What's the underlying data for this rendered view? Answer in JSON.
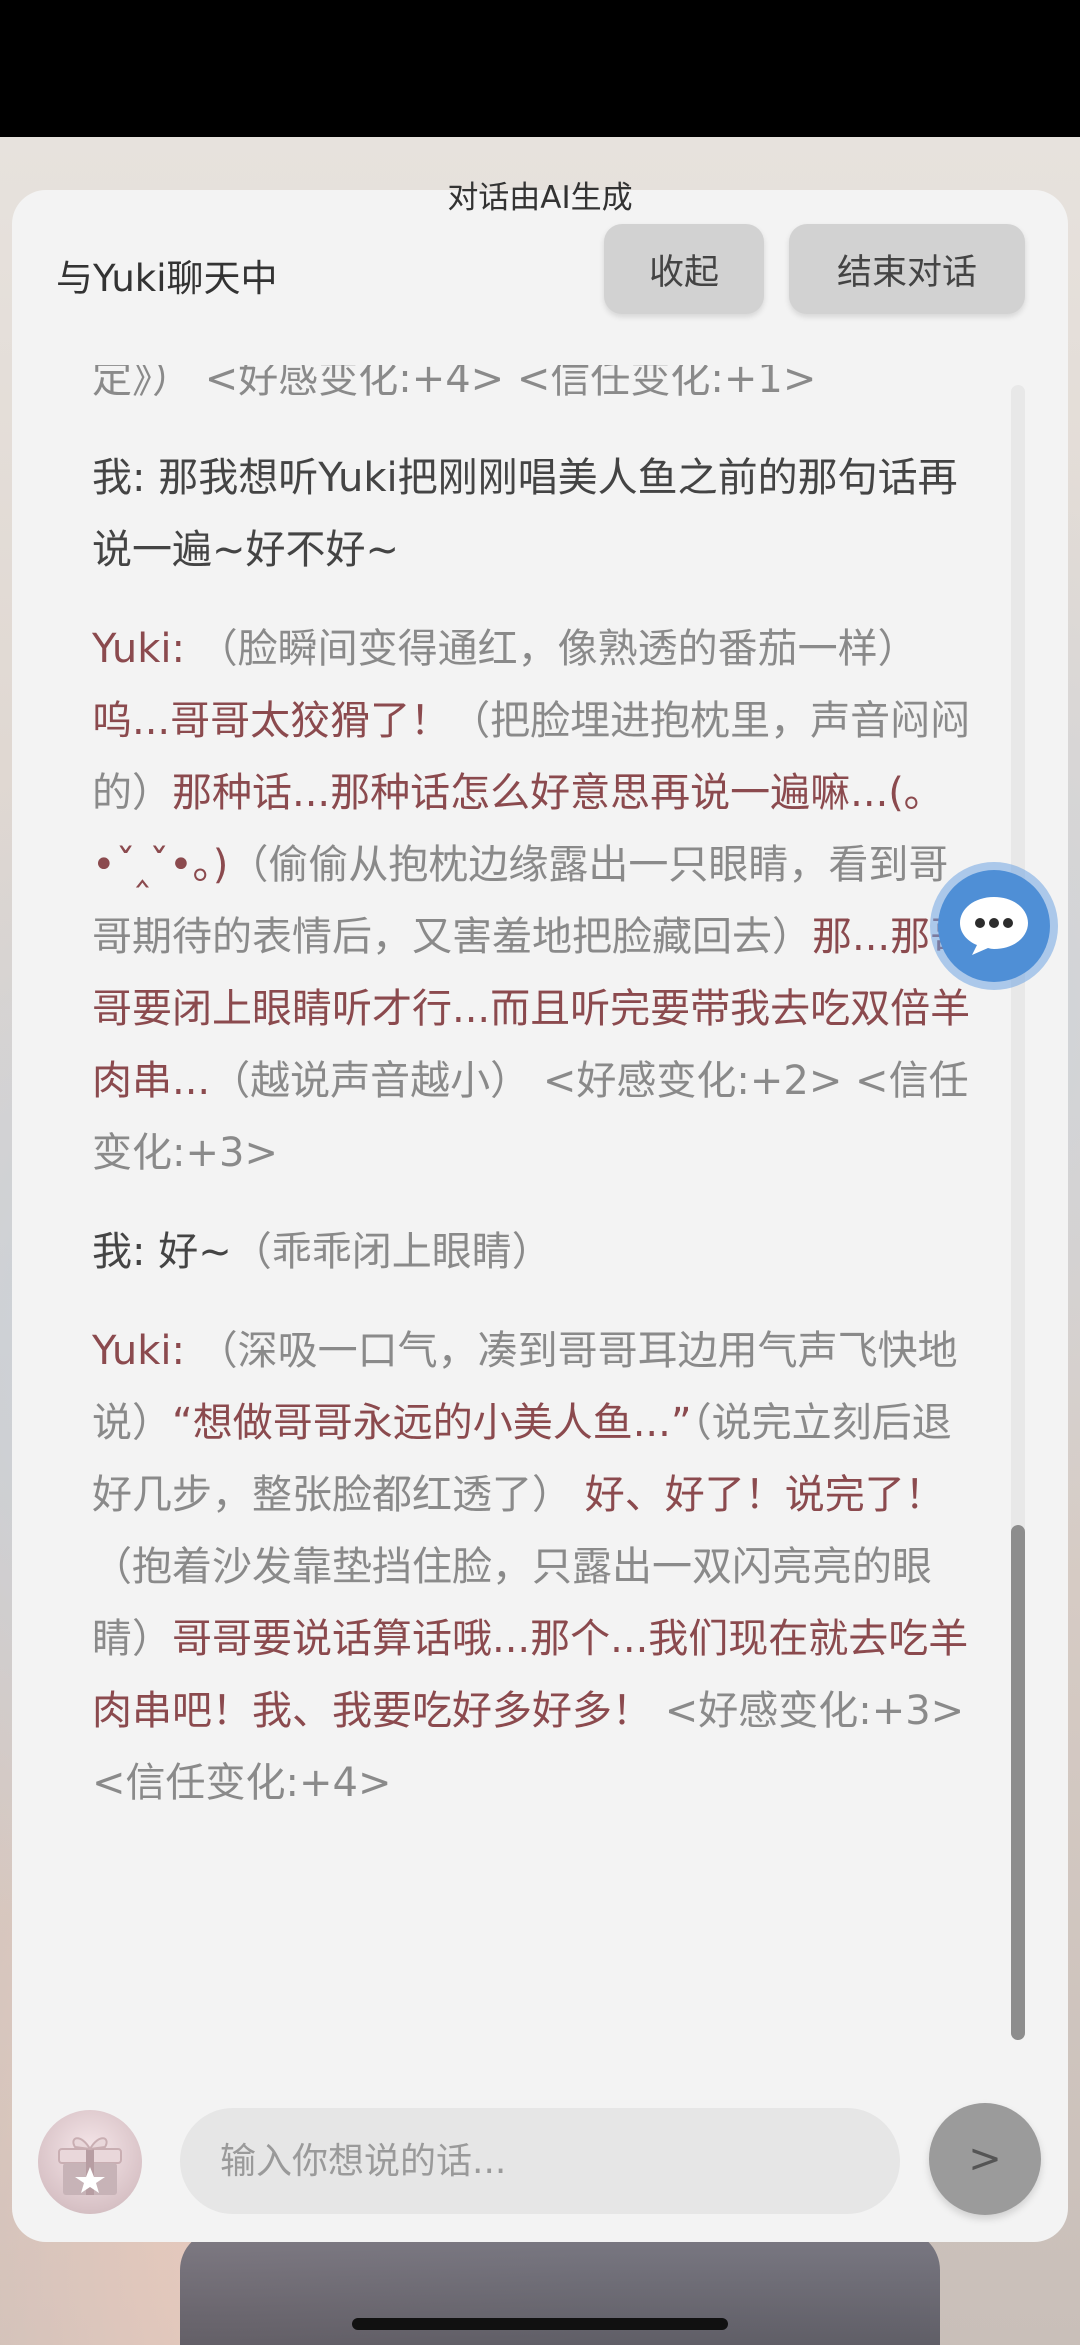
{
  "header": {
    "ai_note": "对话由AI生成",
    "title": "与Yuki聊天中",
    "collapse_label": "收起",
    "end_label": "结束对话"
  },
  "messages": [
    {
      "type": "partial",
      "text": "定》） <好感变化:+4> <信任变化:+1>"
    },
    {
      "type": "me",
      "speaker": "我:",
      "text": " 那我想听Yuki把刚刚唱美人鱼之前的那句话再说一遍~好不好~"
    },
    {
      "type": "yuki",
      "speaker": "Yuki:",
      "segments": [
        {
          "k": "narr",
          "t": " （脸瞬间变得通红，像熟透的番茄一样）"
        },
        {
          "k": "speech",
          "t": "呜...哥哥太狡猾了！"
        },
        {
          "k": "narr",
          "t": "（把脸埋进抱枕里，声音闷闷的）"
        },
        {
          "k": "speech",
          "t": "那种话...那种话怎么好意思再说一遍嘛...(｡•ˇ‸ˇ•｡)"
        },
        {
          "k": "narr",
          "t": "（偷偷从抱枕边缘露出一只眼睛，看到哥哥期待的表情后，又害羞地把脸藏回去）"
        },
        {
          "k": "speech",
          "t": "那...那哥哥要闭上眼睛听才行...而且听完要带我去吃双倍羊肉串..."
        },
        {
          "k": "narr",
          "t": "（越说声音越小） <好感变化:+2> <信任变化:+3>"
        }
      ]
    },
    {
      "type": "me_mixed",
      "speaker": "我:",
      "segments": [
        {
          "k": "me",
          "t": " 好~"
        },
        {
          "k": "narr",
          "t": "（乖乖闭上眼睛）"
        }
      ]
    },
    {
      "type": "yuki",
      "speaker": "Yuki:",
      "segments": [
        {
          "k": "narr",
          "t": " （深吸一口气，凑到哥哥耳边用气声飞快地说）"
        },
        {
          "k": "speech",
          "t": "“想做哥哥永远的小美人鱼...”"
        },
        {
          "k": "narr",
          "t": "（说完立刻后退好几步，整张脸都红透了）"
        },
        {
          "k": "speech",
          "t": " 好、好了！说完了！"
        },
        {
          "k": "narr",
          "t": "（抱着沙发靠垫挡住脸，只露出一双闪亮亮的眼睛）"
        },
        {
          "k": "speech",
          "t": "哥哥要说话算话哦...那个...我们现在就去吃羊肉串吧！我、我要吃好多好多！"
        },
        {
          "k": "narr",
          "t": " <好感变化:+3> <信任变化:+4>"
        }
      ]
    }
  ],
  "input": {
    "placeholder": "输入你想说的话..."
  },
  "send_label": ">",
  "icons": {
    "gift": "gift-box-icon",
    "send": "send-arrow-icon",
    "float": "chat-bubble-icon"
  },
  "colors": {
    "speech": "#8b4a4e",
    "narration": "#8a8a8a",
    "float_button": "#4f8fd6"
  }
}
